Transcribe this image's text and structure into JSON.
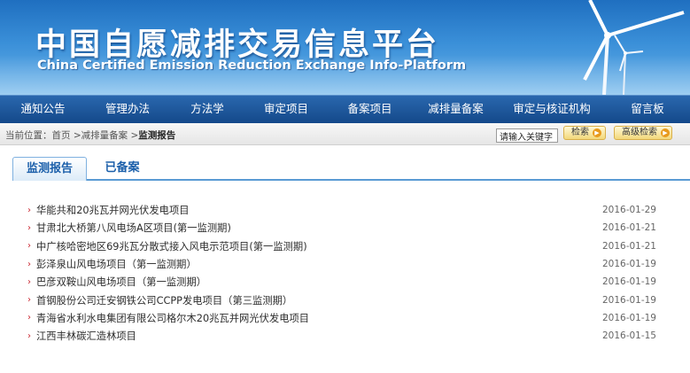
{
  "banner": {
    "title_cn": "中国自愿减排交易信息平台",
    "title_en": "China Certified Emission Reduction Exchange Info-Platform"
  },
  "nav": {
    "items": [
      {
        "label": "通知公告"
      },
      {
        "label": "管理办法"
      },
      {
        "label": "方法学"
      },
      {
        "label": "审定项目"
      },
      {
        "label": "备案项目"
      },
      {
        "label": "减排量备案"
      },
      {
        "label": "审定与核证机构"
      },
      {
        "label": "留言板"
      }
    ]
  },
  "breadcrumb": {
    "prefix": "当前位置：",
    "home": "首页",
    "sep1": " >",
    "section": "减排量备案",
    "sep2": " >",
    "current": "监测报告"
  },
  "search": {
    "placeholder": "请输入关键字",
    "search_label": "检索",
    "advanced_label": "高级检索"
  },
  "tabs": [
    {
      "label": "监测报告",
      "active": true
    },
    {
      "label": "已备案",
      "active": false
    }
  ],
  "list": [
    {
      "title": "华能共和20兆瓦并网光伏发电项目",
      "date": "2016-01-29"
    },
    {
      "title": "甘肃北大桥第八风电场A区项目(第一监测期)",
      "date": "2016-01-21"
    },
    {
      "title": "中广核哈密地区69兆瓦分散式接入风电示范项目(第一监测期)",
      "date": "2016-01-21"
    },
    {
      "title": "彭泽泉山风电场项目（第一监测期）",
      "date": "2016-01-19"
    },
    {
      "title": "巴彦双鞍山风电场项目（第一监测期）",
      "date": "2016-01-19"
    },
    {
      "title": "首钢股份公司迁安钢铁公司CCPP发电项目（第三监测期）",
      "date": "2016-01-19"
    },
    {
      "title": "青海省水利水电集团有限公司格尔木20兆瓦并网光伏发电项目",
      "date": "2016-01-19"
    },
    {
      "title": "江西丰林碳汇造林项目",
      "date": "2016-01-15"
    }
  ],
  "colors": {
    "nav_bg": "#1d5699",
    "banner_bg": "#3a8fd8",
    "bullet": "#c8202a",
    "tab_text": "#1b5faa"
  }
}
